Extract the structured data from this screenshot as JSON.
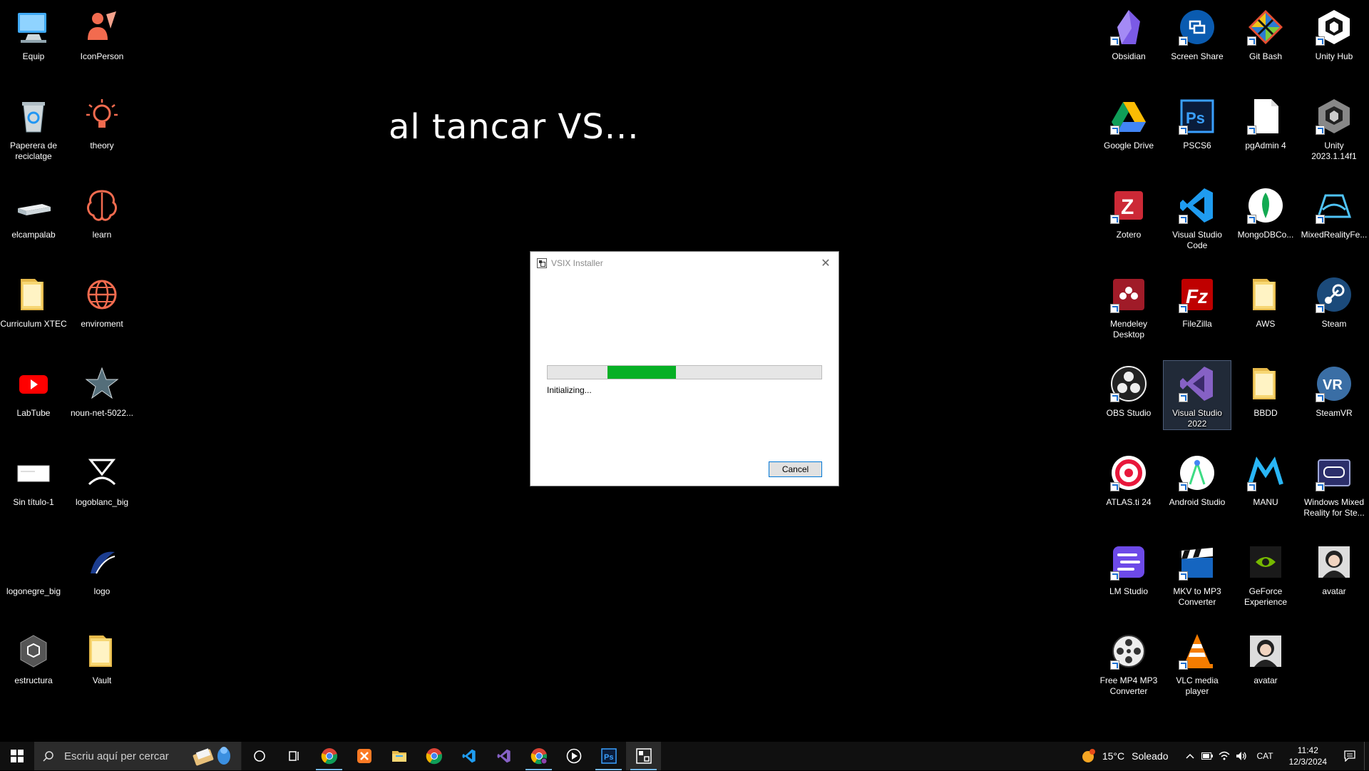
{
  "overlay_text": "al tancar VS...",
  "desktop_icons_left": [
    {
      "label": "Equip",
      "icon": "computer-icon"
    },
    {
      "label": "IconPerson",
      "icon": "person-icon"
    },
    {
      "label": "Paperera de reciclatge",
      "icon": "recycle-bin-icon"
    },
    {
      "label": "theory",
      "icon": "lightbulb-icon"
    },
    {
      "label": "elcampalab",
      "icon": "drive-icon"
    },
    {
      "label": "learn",
      "icon": "brain-icon"
    },
    {
      "label": "Curriculum XTEC",
      "icon": "folder-icon"
    },
    {
      "label": "enviroment",
      "icon": "globe-icon"
    },
    {
      "label": "LabTube",
      "icon": "labtube-icon"
    },
    {
      "label": "noun-net-5022...",
      "icon": "net-icon"
    },
    {
      "label": "Sin título-1",
      "icon": "image-file-icon"
    },
    {
      "label": "logoblanc_big",
      "icon": "logo-white-icon"
    },
    {
      "label": "logonegre_big",
      "icon": "logo-black-icon"
    },
    {
      "label": "logo",
      "icon": "logo-icon"
    },
    {
      "label": "estructura",
      "icon": "unity-file-icon"
    },
    {
      "label": "Vault",
      "icon": "folder-icon"
    }
  ],
  "desktop_icons_right": [
    {
      "label": "Obsidian",
      "icon": "obsidian-icon"
    },
    {
      "label": "Screen Share",
      "icon": "screen-share-icon"
    },
    {
      "label": "Git Bash",
      "icon": "git-bash-icon"
    },
    {
      "label": "Unity Hub",
      "icon": "unity-hub-icon"
    },
    {
      "label": "Google Drive",
      "icon": "google-drive-icon"
    },
    {
      "label": "PSCS6",
      "icon": "photoshop-icon"
    },
    {
      "label": "pgAdmin 4",
      "icon": "file-icon"
    },
    {
      "label": "Unity 2023.1.14f1",
      "icon": "unity-icon"
    },
    {
      "label": "Zotero",
      "icon": "zotero-icon"
    },
    {
      "label": "Visual Studio Code",
      "icon": "vscode-icon"
    },
    {
      "label": "MongoDBCo...",
      "icon": "mongodb-icon"
    },
    {
      "label": "MixedRealityFe...",
      "icon": "mixed-reality-icon"
    },
    {
      "label": "Mendeley Desktop",
      "icon": "mendeley-icon"
    },
    {
      "label": "FileZilla",
      "icon": "filezilla-icon"
    },
    {
      "label": "AWS",
      "icon": "folder-icon"
    },
    {
      "label": "Steam",
      "icon": "steam-icon"
    },
    {
      "label": "OBS Studio",
      "icon": "obs-icon"
    },
    {
      "label": "Visual Studio 2022",
      "icon": "visual-studio-icon",
      "selected": true
    },
    {
      "label": "BBDD",
      "icon": "folder-icon"
    },
    {
      "label": "SteamVR",
      "icon": "steamvr-icon"
    },
    {
      "label": "ATLAS.ti 24",
      "icon": "atlas-ti-icon"
    },
    {
      "label": "Android Studio",
      "icon": "android-studio-icon"
    },
    {
      "label": "MANU",
      "icon": "manu-icon"
    },
    {
      "label": "Windows Mixed Reality for Ste...",
      "icon": "wmr-icon"
    },
    {
      "label": "LM Studio",
      "icon": "lm-studio-icon"
    },
    {
      "label": "MKV to MP3 Converter",
      "icon": "mkv-converter-icon"
    },
    {
      "label": "GeForce Experience",
      "icon": "geforce-icon"
    },
    {
      "label": "avatar",
      "icon": "avatar-icon"
    },
    {
      "label": "Free MP4 MP3 Converter",
      "icon": "film-reel-icon"
    },
    {
      "label": "VLC media player",
      "icon": "vlc-icon"
    },
    {
      "label": "avatar",
      "icon": "avatar-icon"
    }
  ],
  "dialog": {
    "title": "VSIX Installer",
    "status": "Initializing...",
    "cancel_label": "Cancel",
    "progress_start": 0.22,
    "progress_end": 0.47,
    "progress_color": "#06b025"
  },
  "taskbar": {
    "search_placeholder": "Escriu aquí per cercar",
    "apps": [
      {
        "icon": "task-view-icon"
      },
      {
        "icon": "widgets-icon"
      },
      {
        "icon": "chrome-icon",
        "running": true
      },
      {
        "icon": "xampp-icon"
      },
      {
        "icon": "file-explorer-icon"
      },
      {
        "icon": "chrome-icon"
      },
      {
        "icon": "vscode-icon"
      },
      {
        "icon": "visual-studio-icon"
      },
      {
        "icon": "chrome-profile-icon",
        "running": true
      },
      {
        "icon": "media-player-icon"
      },
      {
        "icon": "photoshop-icon",
        "running": true
      },
      {
        "icon": "vsix-installer-icon",
        "running": true,
        "active": true
      }
    ],
    "weather_temp": "15°C",
    "weather_desc": "Soleado",
    "language": "CAT",
    "time": "11:42",
    "date": "12/3/2024"
  },
  "colors": {
    "desktop_bg": "#000000",
    "taskbar_bg": "#101010",
    "accent": "#0078d7"
  }
}
